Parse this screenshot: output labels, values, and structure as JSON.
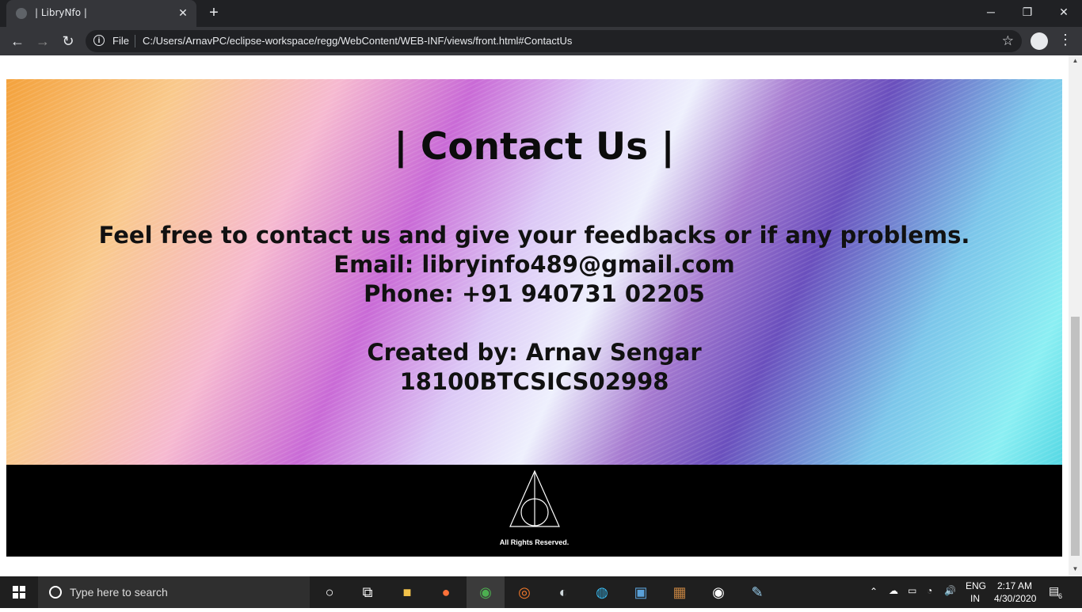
{
  "browser": {
    "tab_title": "| LibryNfo |",
    "new_tab": "+",
    "file_label": "File",
    "url": "C:/Users/ArnavPC/eclipse-workspace/regg/WebContent/WEB-INF/views/front.html#ContactUs"
  },
  "contact": {
    "title": "| Contact Us |",
    "message": "Feel free to contact us and give your feedbacks or if any problems.",
    "email": "Email: libryinfo489@gmail.com",
    "phone": "Phone: +91 940731 02205",
    "created_by": "Created by: Arnav Sengar",
    "roll_no": "18100BTCSICS02998"
  },
  "footer": {
    "rights": "All Rights Reserved."
  },
  "taskbar": {
    "search_placeholder": "Type here to search",
    "apps": [
      "cortana-icon",
      "task-view-icon",
      "file-explorer-icon",
      "firefox-icon",
      "chrome-icon",
      "blender-icon",
      "eclipse-icon",
      "edge-icon",
      "mysql-workbench-icon",
      "game-icon",
      "obs-icon",
      "paint-icon"
    ],
    "lang": "ENG",
    "region": "IN",
    "time": "2:17 AM",
    "date": "4/30/2020",
    "notifications": "6"
  },
  "colors": {
    "chrome_dark": "#202124",
    "toolbar": "#35363a",
    "footer": "#000000"
  }
}
